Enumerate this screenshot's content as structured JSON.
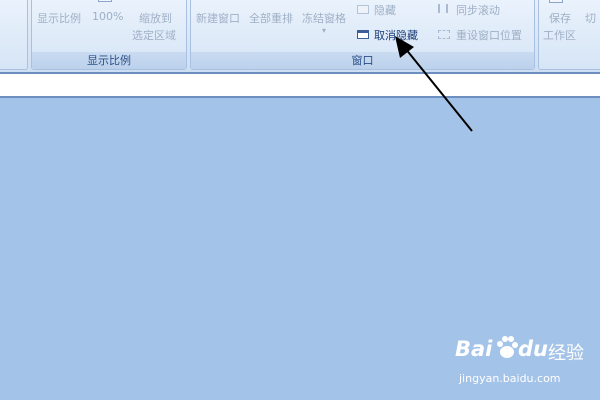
{
  "ribbon": {
    "zoom_group": {
      "label": "显示比例",
      "zoom_button": "显示比例",
      "hundred_button": "100%",
      "zoom_to_sel_line1": "缩放到",
      "zoom_to_sel_line2": "选定区域"
    },
    "window_group": {
      "label": "窗口",
      "new_window": "新建窗口",
      "arrange_all": "全部重排",
      "freeze_panes": "冻结窗格",
      "hide": "隐藏",
      "unhide": "取消隐藏",
      "sync_scroll": "同步滚动",
      "reset_position": "重设窗口位置",
      "save_workspace_line1": "保存",
      "save_workspace_line2": "工作区",
      "switch_window": "切"
    }
  },
  "watermark": {
    "brand": "Bai",
    "brand2": "du",
    "suffix": "经验",
    "url": "jingyan.baidu.com"
  },
  "colors": {
    "workspace": "#a4c3e8",
    "arrow": "#000000",
    "active_text": "#1b3f78"
  }
}
